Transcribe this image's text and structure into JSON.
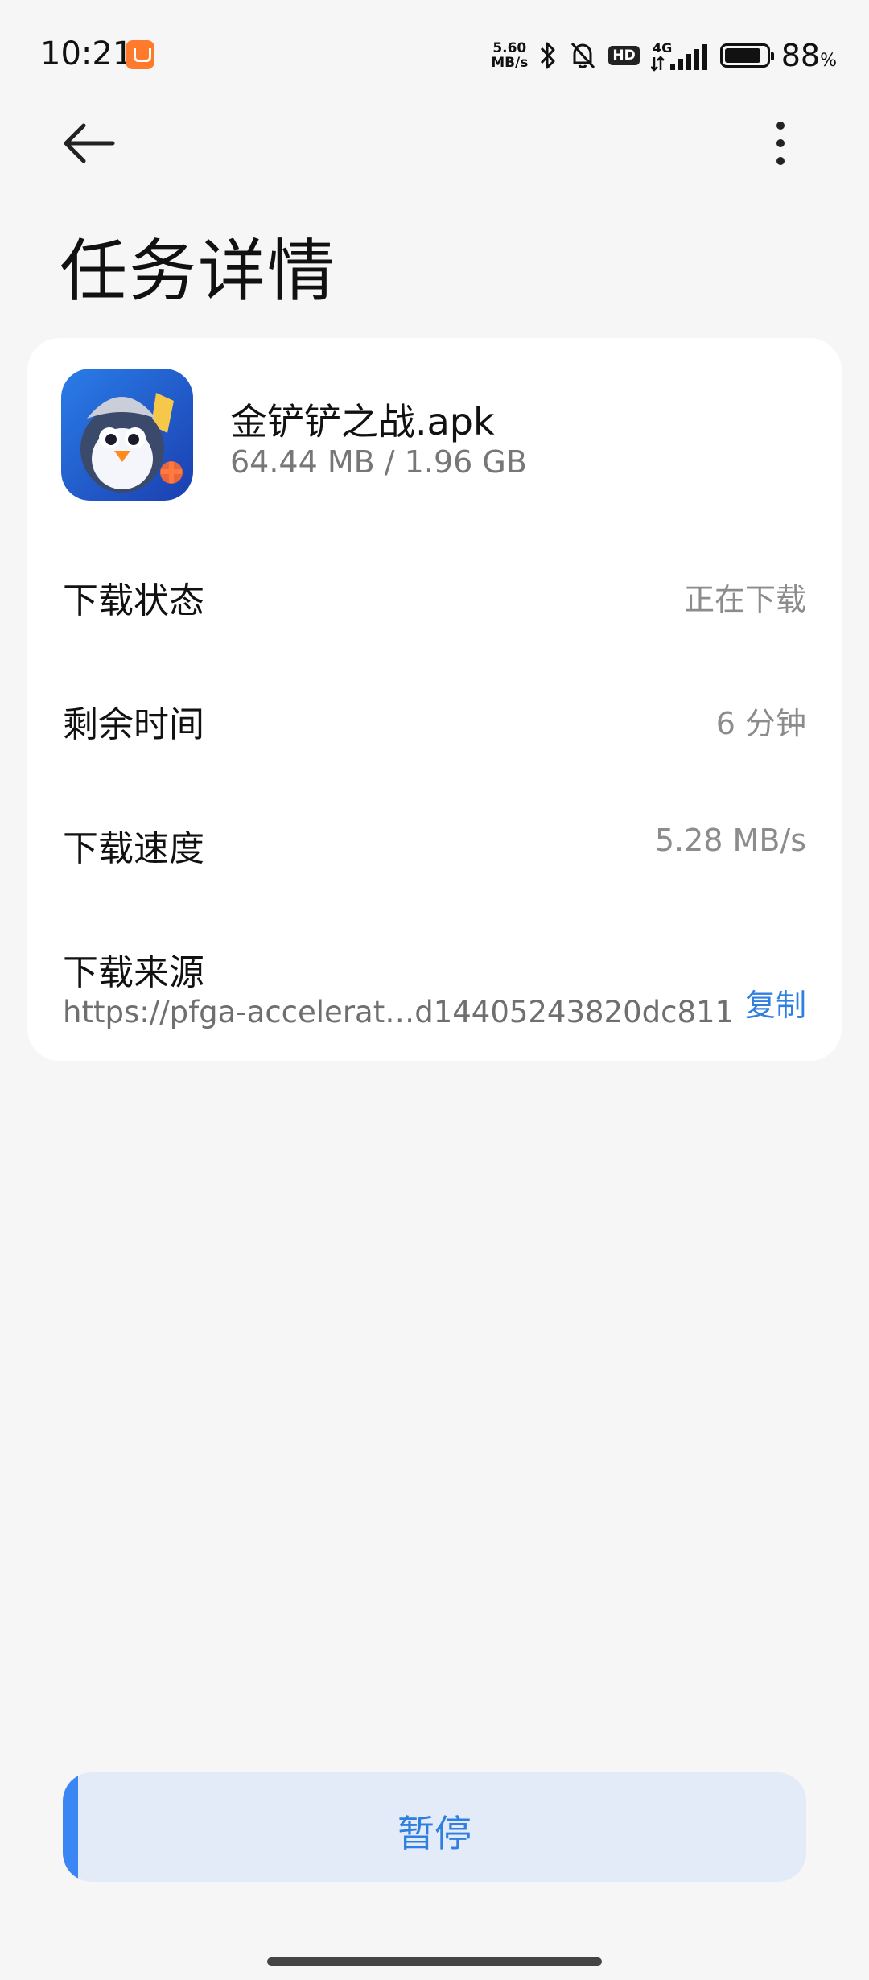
{
  "status_bar": {
    "time": "10:21",
    "net_speed_value": "5.60",
    "net_speed_unit": "MB/s",
    "hd": "HD",
    "network": "4G",
    "battery_percent": "88",
    "battery_level": 0.88,
    "percent_sign": "%"
  },
  "header": {
    "title": "任务详情",
    "back_icon": "arrow-left-icon",
    "more_icon": "more-vertical-icon"
  },
  "task": {
    "file_name": "金铲铲之战.apk",
    "size_progress": "64.44 MB / 1.96 GB",
    "status_label": "下载状态",
    "status_value": "正在下载",
    "remaining_label": "剩余时间",
    "remaining_value": "6 分钟",
    "speed_label": "下载速度",
    "speed_value": "5.28 MB/s",
    "source_label": "下载来源",
    "source_url": "https://pfga-accelerat…d14405243820dc811",
    "copy_label": "复制"
  },
  "action": {
    "pause_label": "暂停",
    "progress": 0.021
  },
  "colors": {
    "accent": "#2f7fe0",
    "progress_fill": "#3a86f5",
    "button_bg": "#e3ebf8",
    "background": "#f6f6f6"
  }
}
